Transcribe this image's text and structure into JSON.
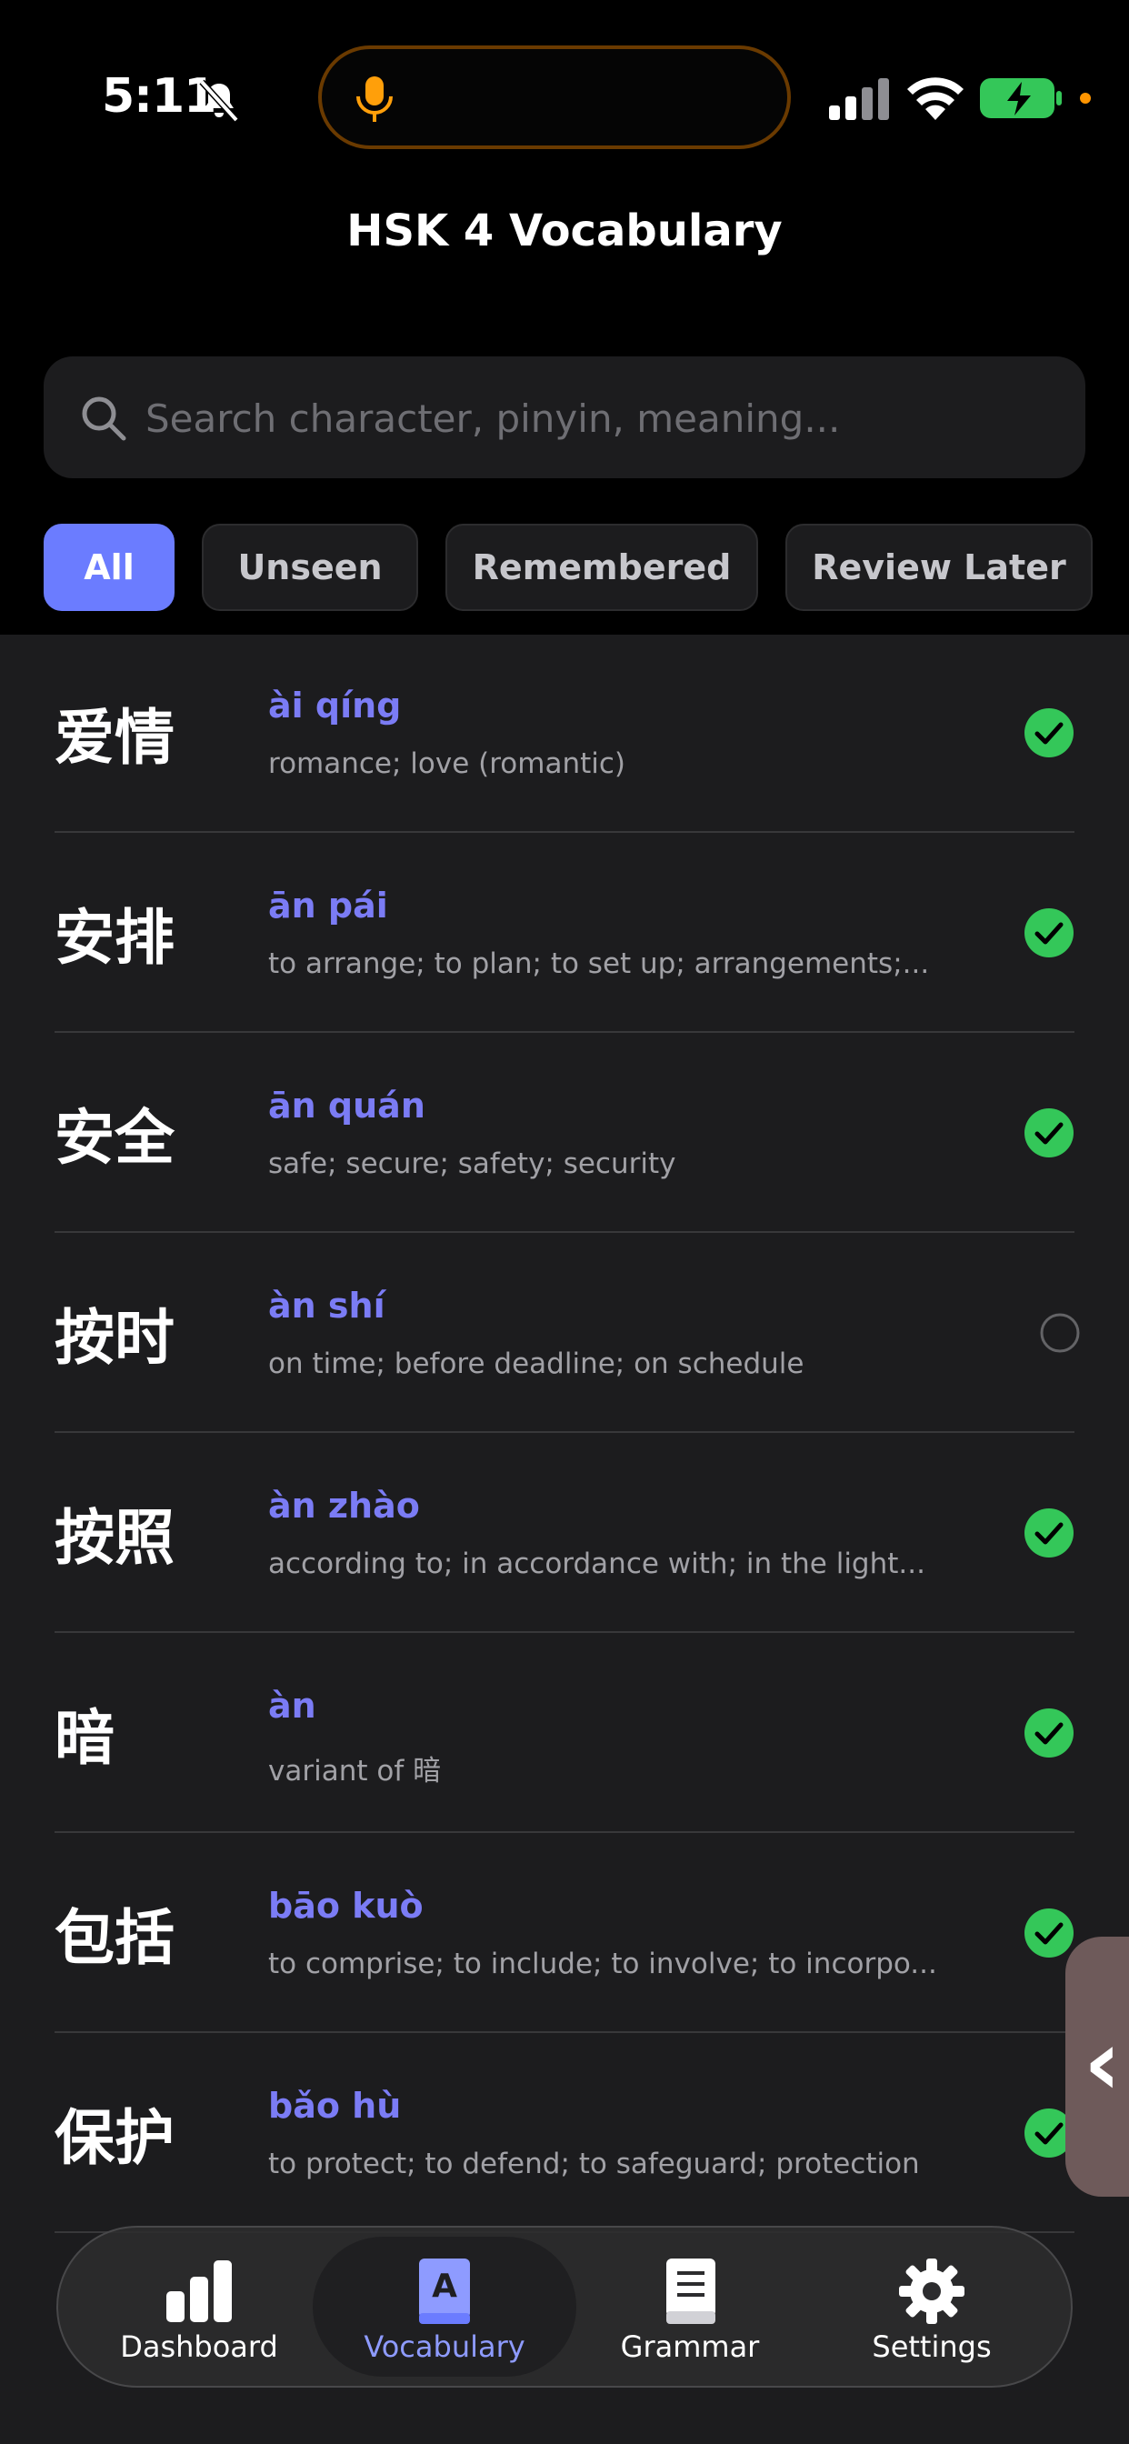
{
  "status_bar": {
    "time": "5:11"
  },
  "header": {
    "title": "HSK 4 Vocabulary"
  },
  "search": {
    "placeholder": "Search character, pinyin, meaning..."
  },
  "filters": [
    {
      "label": "All",
      "active": true
    },
    {
      "label": "Unseen",
      "active": false
    },
    {
      "label": "Remembered",
      "active": false
    },
    {
      "label": "Review Later",
      "active": false
    }
  ],
  "words": [
    {
      "hanzi": "爱情",
      "pinyin": "ài qíng",
      "meaning": "romance; love (romantic)",
      "status": "remembered"
    },
    {
      "hanzi": "安排",
      "pinyin": "ān pái",
      "meaning": "to arrange; to plan; to set up; arrangements;...",
      "status": "remembered"
    },
    {
      "hanzi": "安全",
      "pinyin": "ān quán",
      "meaning": "safe; secure; safety; security",
      "status": "remembered"
    },
    {
      "hanzi": "按时",
      "pinyin": "àn shí",
      "meaning": "on time; before deadline; on schedule",
      "status": "unseen"
    },
    {
      "hanzi": "按照",
      "pinyin": "àn zhào",
      "meaning": "according to; in accordance with; in the light...",
      "status": "remembered"
    },
    {
      "hanzi": "暗",
      "pinyin": "àn",
      "meaning": "variant of 暗",
      "status": "remembered"
    },
    {
      "hanzi": "包括",
      "pinyin": "bāo kuò",
      "meaning": "to comprise; to include; to involve; to incorpo...",
      "status": "remembered"
    },
    {
      "hanzi": "保护",
      "pinyin": "bǎo hù",
      "meaning": "to protect; to defend; to safeguard; protection",
      "status": "remembered"
    }
  ],
  "tabbar": {
    "dashboard": "Dashboard",
    "vocabulary": "Vocabulary",
    "grammar": "Grammar",
    "settings": "Settings"
  },
  "colors": {
    "accent": "#6b7cff",
    "pinyin": "#7b7cf5",
    "remembered": "#34c759",
    "background": "#1c1c1e"
  }
}
